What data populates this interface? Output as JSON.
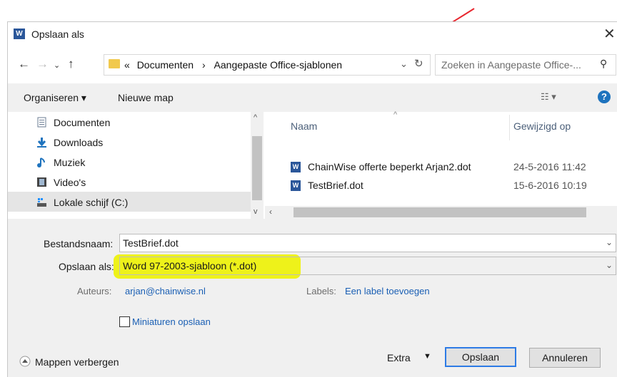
{
  "window": {
    "title": "Opslaan als"
  },
  "address": {
    "crumbs": [
      "«",
      "Documenten",
      "›",
      "Aangepaste Office-sjablonen"
    ]
  },
  "search": {
    "placeholder": "Zoeken in Aangepaste Office-..."
  },
  "toolbar": {
    "organize": "Organiseren ▾",
    "new_folder": "Nieuwe map"
  },
  "nav_items": [
    {
      "label": "Documenten",
      "icon": "document-icon"
    },
    {
      "label": "Downloads",
      "icon": "download-icon"
    },
    {
      "label": "Muziek",
      "icon": "music-icon"
    },
    {
      "label": "Video's",
      "icon": "video-icon"
    },
    {
      "label": "Lokale schijf (C:)",
      "icon": "drive-icon",
      "selected": true
    }
  ],
  "columns": {
    "name": "Naam",
    "modified": "Gewijzigd op"
  },
  "files": [
    {
      "name": "ChainWise offerte beperkt Arjan2.dot",
      "modified": "24-5-2016 11:42"
    },
    {
      "name": "TestBrief.dot",
      "modified": "15-6-2016 10:19"
    }
  ],
  "form": {
    "filename_label": "Bestandsnaam:",
    "filename_value": "TestBrief.dot",
    "type_label": "Opslaan als:",
    "type_value": "Word 97-2003-sjabloon (*.dot)",
    "authors_label": "Auteurs:",
    "authors_value": "arjan@chainwise.nl",
    "labels_label": "Labels:",
    "labels_value": "Een label toevoegen",
    "thumbnails_label": "Miniaturen opslaan"
  },
  "footer": {
    "hide_folders": "Mappen verbergen",
    "tools": "Extra",
    "save": "Opslaan",
    "cancel": "Annuleren"
  },
  "colors": {
    "annotation_arrow": "#e8262e",
    "highlight": "#eef21a",
    "word_blue": "#2b579a"
  }
}
